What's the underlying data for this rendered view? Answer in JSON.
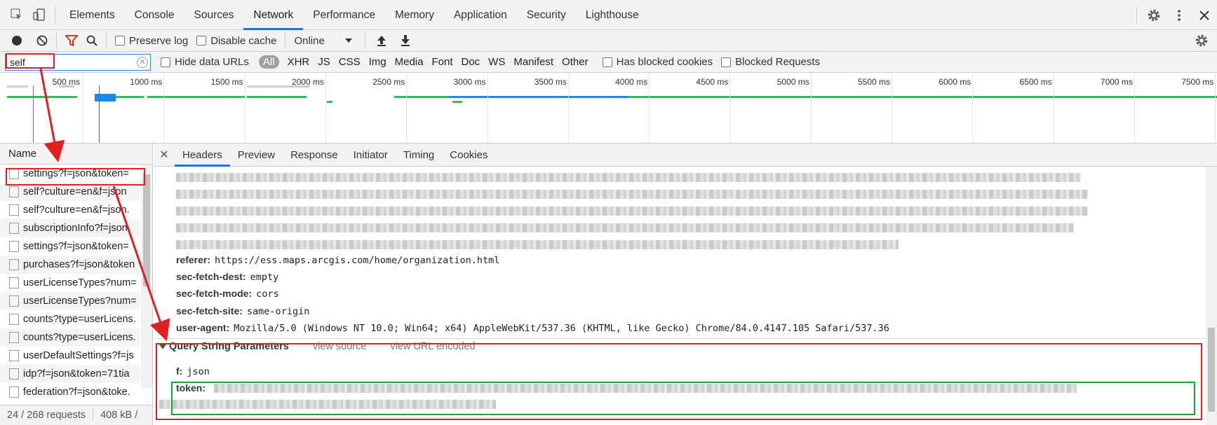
{
  "topbar": {
    "tabs": [
      "Elements",
      "Console",
      "Sources",
      "Network",
      "Performance",
      "Memory",
      "Application",
      "Security",
      "Lighthouse"
    ],
    "active_tab": "Network"
  },
  "toolbar": {
    "preserve_log": "Preserve log",
    "disable_cache": "Disable cache",
    "throttling": "Online"
  },
  "filter": {
    "value": "self",
    "hide_data_urls": "Hide data URLs",
    "types": [
      "All",
      "XHR",
      "JS",
      "CSS",
      "Img",
      "Media",
      "Font",
      "Doc",
      "WS",
      "Manifest",
      "Other"
    ],
    "has_blocked_cookies": "Has blocked cookies",
    "blocked_requests": "Blocked Requests"
  },
  "timeline": {
    "ticks": [
      "500 ms",
      "1000 ms",
      "1500 ms",
      "2000 ms",
      "2500 ms",
      "3000 ms",
      "3500 ms",
      "4000 ms",
      "4500 ms",
      "5000 ms",
      "5500 ms",
      "6000 ms",
      "6500 ms",
      "7000 ms",
      "7500 ms"
    ]
  },
  "requests": {
    "header": "Name",
    "items": [
      "settings?f=json&token=",
      "self?culture=en&f=json",
      "self?culture=en&f=json.",
      "subscriptionInfo?f=json.",
      "settings?f=json&token=",
      "purchases?f=json&token",
      "userLicenseTypes?num=",
      "userLicenseTypes?num=",
      "counts?type=userLicens.",
      "counts?type=userLicens.",
      "userDefaultSettings?f=js",
      "idp?f=json&token=71tia",
      "federation?f=json&toke."
    ]
  },
  "status": {
    "requests": "24 / 268 requests",
    "size": "408 kB /"
  },
  "detail": {
    "tabs": [
      "Headers",
      "Preview",
      "Response",
      "Initiator",
      "Timing",
      "Cookies"
    ],
    "active_tab": "Headers",
    "headers": [
      {
        "name": "referer:",
        "value": "https://ess.maps.arcgis.com/home/organization.html"
      },
      {
        "name": "sec-fetch-dest:",
        "value": "empty"
      },
      {
        "name": "sec-fetch-mode:",
        "value": "cors"
      },
      {
        "name": "sec-fetch-site:",
        "value": "same-origin"
      },
      {
        "name": "user-agent:",
        "value": "Mozilla/5.0 (Windows NT 10.0; Win64; x64) AppleWebKit/537.36 (KHTML, like Gecko) Chrome/84.0.4147.105 Safari/537.36"
      }
    ],
    "query_section": {
      "title": "Query String Parameters",
      "view_source": "view source",
      "view_url_encoded": "view URL encoded",
      "params": [
        {
          "name": "f:",
          "value": "json"
        },
        {
          "name": "token:",
          "value": ""
        }
      ]
    }
  },
  "colors": {
    "annotation_red": "#e02020",
    "annotation_green": "#22a038",
    "accent": "#1a73e8"
  }
}
